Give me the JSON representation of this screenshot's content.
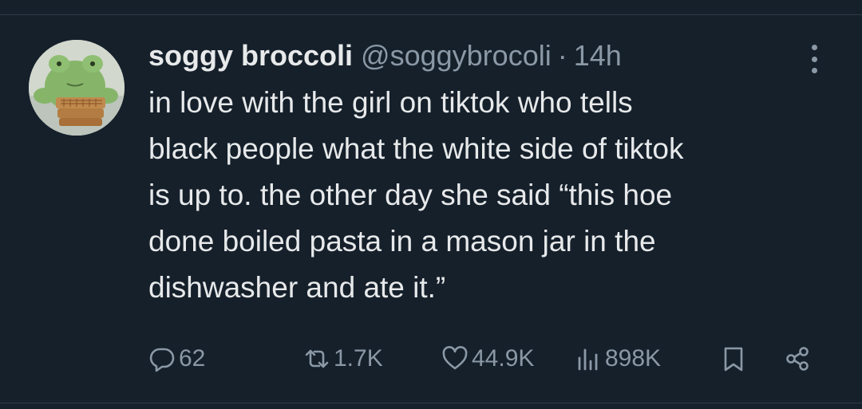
{
  "tweet": {
    "author_name": "soggy broccoli",
    "handle": "@soggybrocoli",
    "separator": "·",
    "time": "14h",
    "text": "in love with the girl on tiktok who tells\nblack people what the white side of tiktok\nis up to. the other day she said “this hoe\ndone boiled pasta in a mason jar in the\ndishwasher and ate it.”"
  },
  "actions": {
    "reply_count": "62",
    "retweet_count": "1.7K",
    "like_count": "44.9K",
    "view_count": "898K"
  },
  "icons": {
    "more": "more-vertical-icon",
    "reply": "reply-icon",
    "retweet": "retweet-icon",
    "like": "heart-icon",
    "views": "views-bar-chart-icon",
    "bookmark": "bookmark-icon",
    "share": "share-icon"
  },
  "colors": {
    "background": "#15202b",
    "text_primary": "#e7e9ea",
    "text_secondary": "#8b98a5",
    "divider": "#2f3b47"
  }
}
